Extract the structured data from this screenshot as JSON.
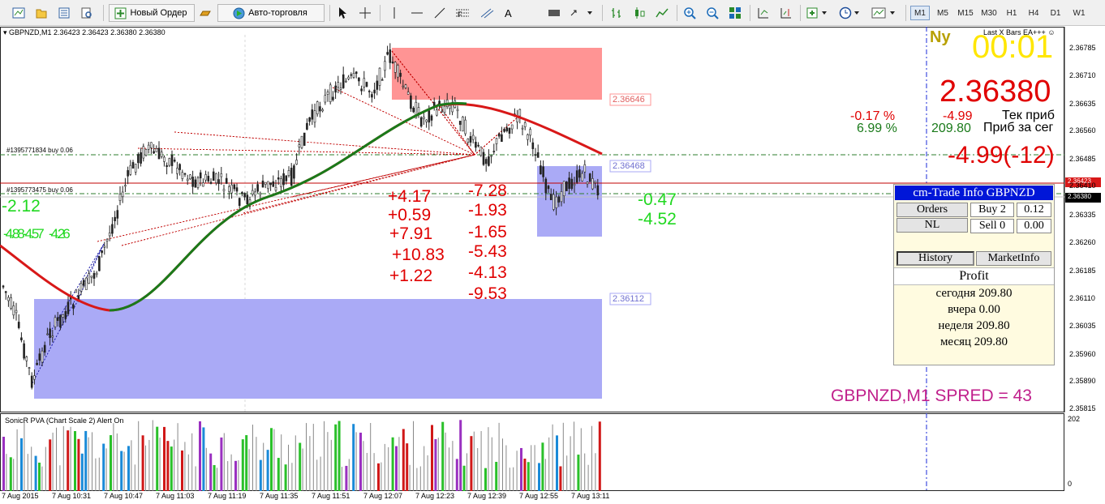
{
  "toolbar": {
    "new_order_label": "Новый Ордер",
    "auto_trading_label": "Авто-торговля",
    "timeframes": [
      "M1",
      "M5",
      "M15",
      "M30",
      "H1",
      "H4",
      "D1",
      "W1"
    ],
    "active_timeframe": "M1",
    "icons": [
      "new-chart-icon",
      "profiles-icon",
      "market-watch-icon",
      "navigator-icon",
      "new-order-icon",
      "gold-bar-icon",
      "auto-trading-icon",
      "cursor-icon",
      "crosshair-icon",
      "vertical-line-icon",
      "horizontal-line-icon",
      "trendline-icon",
      "fibonacci-icon",
      "channels-icon",
      "text-icon",
      "label-icon",
      "arrows-icon",
      "bar-chart-icon",
      "candlestick-icon",
      "line-chart-icon",
      "zoom-in-icon",
      "zoom-out-icon",
      "tile-windows-icon",
      "autoscroll-icon",
      "chart-shift-icon",
      "indicators-icon",
      "periods-icon",
      "templates-icon"
    ]
  },
  "chart": {
    "header": "GBPNZD,M1  2.36423 2.36423 2.36380 2.36380",
    "ea_name": "Last X Bars EA+++",
    "ea_status": "☺",
    "ny_label": "Ny",
    "countdown": "00:01",
    "current_price": "2.36380",
    "pct_current": "-0.17 %",
    "value_current": "-4.99",
    "label_current": "Тек приб",
    "pct_gain": "6.99 %",
    "value_gain": "209.80",
    "label_gain": "Приб за сег",
    "total_profit": "-4.99(-12)",
    "order1_label": "#1395771834 buy 0.06",
    "order2_label": "#1395773475 buy 0.06",
    "zone_prices": [
      "2.36646",
      "2.36468",
      "2.36112"
    ],
    "bid_tag": "2.36423",
    "ask_tag": "2.36380",
    "left_value": "-2.12",
    "overlap_values": [
      "-4.88",
      "-4.57",
      "-4.26"
    ],
    "plus_values": [
      "+4.17",
      "+0.59",
      "+7.91",
      "+10.83",
      "+1.22"
    ],
    "minus_values": [
      "-7.28",
      "-1.93",
      "-1.65",
      "-5.43",
      "-4.13",
      "-9.53"
    ],
    "right_values": [
      "-0.47",
      "-4.52"
    ],
    "symbol_spread": "GBPNZD,M1   SPRED = 43",
    "price_ticks": [
      "2.36785",
      "2.36710",
      "2.36635",
      "2.36560",
      "2.36485",
      "2.36410",
      "2.36335",
      "2.36260",
      "2.36185",
      "2.36110",
      "2.36035",
      "2.35960",
      "2.35890",
      "2.35815"
    ],
    "time_ticks": [
      "7 Aug 2015",
      "7 Aug 10:31",
      "7 Aug 10:47",
      "7 Aug 11:03",
      "7 Aug 11:19",
      "7 Aug 11:35",
      "7 Aug 11:51",
      "7 Aug 12:07",
      "7 Aug 12:23",
      "7 Aug 12:39",
      "7 Aug 12:55",
      "7 Aug 13:11"
    ],
    "colors": {
      "bull": "#008000",
      "bear": "#e00000",
      "zone_red": "#ff8c8c",
      "zone_blue": "#a8a8f8",
      "magenta": "#c0208c",
      "yellow": "#ffe600"
    }
  },
  "indicator": {
    "label": "SonicR PVA  (Chart Scale 2)  Alert On",
    "scale_max": "202",
    "scale_min": "0"
  },
  "trade_panel": {
    "title": "cm-Trade Info GBPNZD",
    "orders_label": "Orders",
    "buy_label": "Buy 2",
    "buy_value": "0.12",
    "nl_label": "NL",
    "sell_label": "Sell 0",
    "sell_value": "0.00",
    "tab_history": "History",
    "tab_market": "MarketInfo",
    "profit_title": "Profit",
    "today": "сегодня 209.80",
    "yesterday": "вчера 0.00",
    "week": "неделя 209.80",
    "month": "месяц 209.80"
  }
}
